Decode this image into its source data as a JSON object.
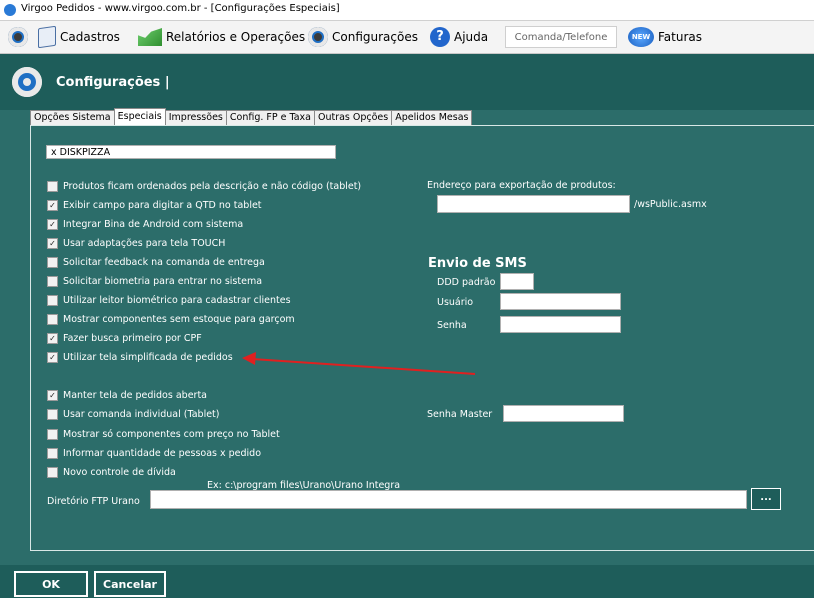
{
  "window": {
    "title": "Virgoo Pedidos - www.virgoo.com.br - [Configurações Especiais]"
  },
  "toolbar": {
    "cadastros": "Cadastros",
    "relatorios": "Relatórios e Operações",
    "configuracoes": "Configurações",
    "ajuda": "Ajuda",
    "comanda_placeholder": "Comanda/Telefone",
    "new_badge": "NEW",
    "faturas": "Faturas"
  },
  "header": {
    "title": "Configurações |"
  },
  "tabs": [
    "Opções Sistema",
    "Especiais",
    "Impressões",
    "Config. FP e Taxa",
    "Outras Opções",
    "Apelidos Mesas"
  ],
  "company_field": "x  DISKPIZZA",
  "options_a": [
    {
      "label": "Produtos ficam ordenados pela descrição e não código (tablet)",
      "checked": false
    },
    {
      "label": "Exibir campo para digitar a QTD no tablet",
      "checked": true
    },
    {
      "label": "Integrar Bina de Android com sistema",
      "checked": true
    },
    {
      "label": "Usar adaptações para tela TOUCH",
      "checked": true
    },
    {
      "label": "Solicitar feedback na comanda de entrega",
      "checked": false
    },
    {
      "label": "Solicitar biometria para entrar no sistema",
      "checked": false
    },
    {
      "label": "Utilizar leitor biométrico para cadastrar clientes",
      "checked": false
    },
    {
      "label": "Mostrar componentes sem estoque para garçom",
      "checked": false
    },
    {
      "label": "Fazer busca primeiro por CPF",
      "checked": true
    },
    {
      "label": "Utilizar tela simplificada de pedidos",
      "checked": true
    }
  ],
  "options_b": [
    {
      "label": "Manter tela de pedidos aberta",
      "checked": true
    },
    {
      "label": "Usar comanda individual (Tablet)",
      "checked": false
    },
    {
      "label": "Mostrar só componentes com preço no Tablet",
      "checked": false
    },
    {
      "label": "Informar quantidade de pessoas x pedido",
      "checked": false
    },
    {
      "label": "Novo controle de dívida",
      "checked": false
    }
  ],
  "export": {
    "label": "Endereço para exportação de produtos:",
    "value": "",
    "suffix": "/wsPublic.asmx"
  },
  "sms": {
    "title": "Envio de SMS",
    "ddd_label": "DDD padrão",
    "ddd_value": "",
    "user_label": "Usuário",
    "user_value": "",
    "password_label": "Senha",
    "password_value": ""
  },
  "senha_master": {
    "label": "Senha Master",
    "value": ""
  },
  "ftp": {
    "hint": "Ex: c:\\program files\\Urano\\Urano Integra",
    "label": "Diretório FTP Urano",
    "value": "",
    "browse": "..."
  },
  "buttons": {
    "ok": "OK",
    "cancel": "Cancelar"
  },
  "annotation_color": "#e02020"
}
